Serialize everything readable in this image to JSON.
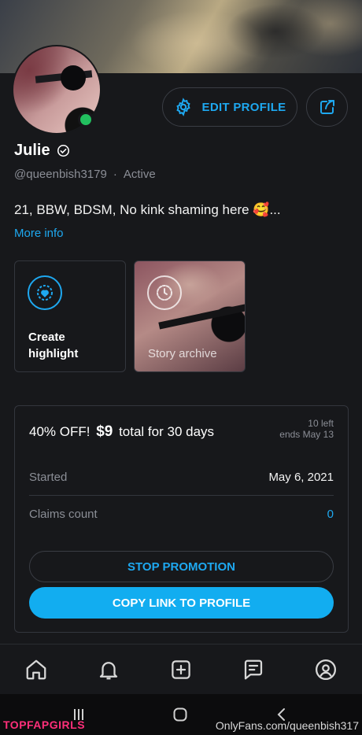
{
  "profile": {
    "name": "Julie",
    "handle": "@queenbish3179",
    "status": "Active",
    "bio": "21, BBW, BDSM, No kink shaming here 🥰...",
    "more_info": "More info"
  },
  "actions": {
    "edit_profile": "EDIT PROFILE"
  },
  "highlights": {
    "create_line1": "Create",
    "create_line2": "highlight",
    "archive": "Story archive"
  },
  "promotion": {
    "discount": "40% OFF!",
    "price": "$9",
    "duration": "total for 30 days",
    "left": "10 left",
    "ends": "ends May 13",
    "started_label": "Started",
    "started_value": "May 6, 2021",
    "claims_label": "Claims count",
    "claims_value": "0",
    "stop_button": "STOP PROMOTION",
    "copy_button": "COPY LINK TO PROFILE"
  },
  "tabs": [
    "home-icon",
    "bell-icon",
    "add-post-icon",
    "messages-icon",
    "profile-icon"
  ],
  "watermarks": {
    "left": "TOPFAPGIRLS",
    "right": "OnlyFans.com/queenbish317"
  },
  "colors": {
    "accent": "#1ea8f0",
    "background": "#17181b",
    "online": "#22c05f"
  }
}
